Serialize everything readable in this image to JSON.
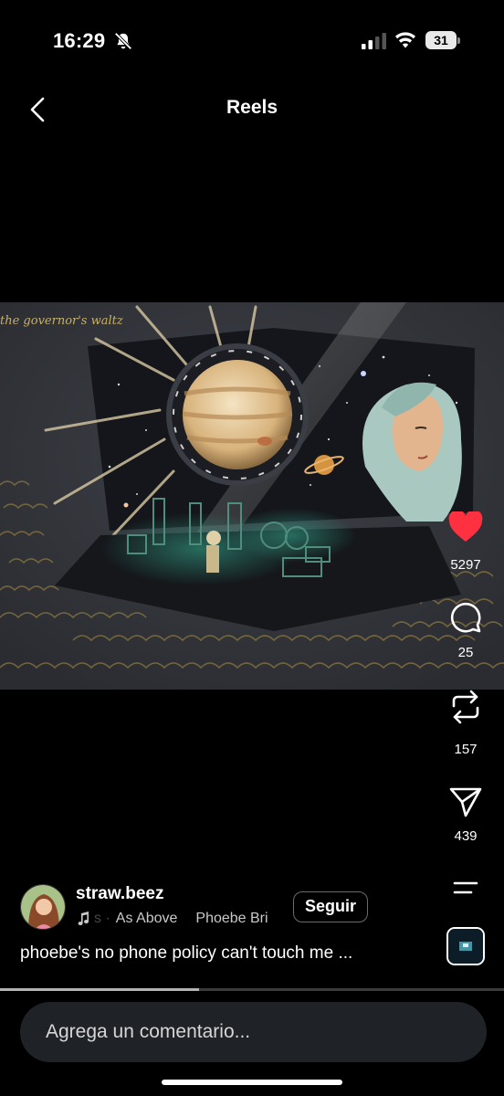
{
  "status_bar": {
    "time": "16:29",
    "battery": "31"
  },
  "header": {
    "title": "Reels"
  },
  "actions": {
    "likes": "5297",
    "comments": "25",
    "reposts": "157",
    "shares": "439"
  },
  "post": {
    "username": "straw.beez",
    "music_track": "As Above",
    "music_artist": "Phoebe Bri",
    "music_prefix": "s ·",
    "follow_label": "Seguir",
    "caption": "phoebe's no phone policy can't touch me ..."
  },
  "progress": {
    "value": 0.395
  },
  "comment": {
    "placeholder": "Agrega un comentario..."
  },
  "artwork": {
    "handwritten_text": "the governor's waltz"
  },
  "colors": {
    "like_red": "#ff3040",
    "background": "#000000",
    "comment_box": "#1f2226"
  }
}
